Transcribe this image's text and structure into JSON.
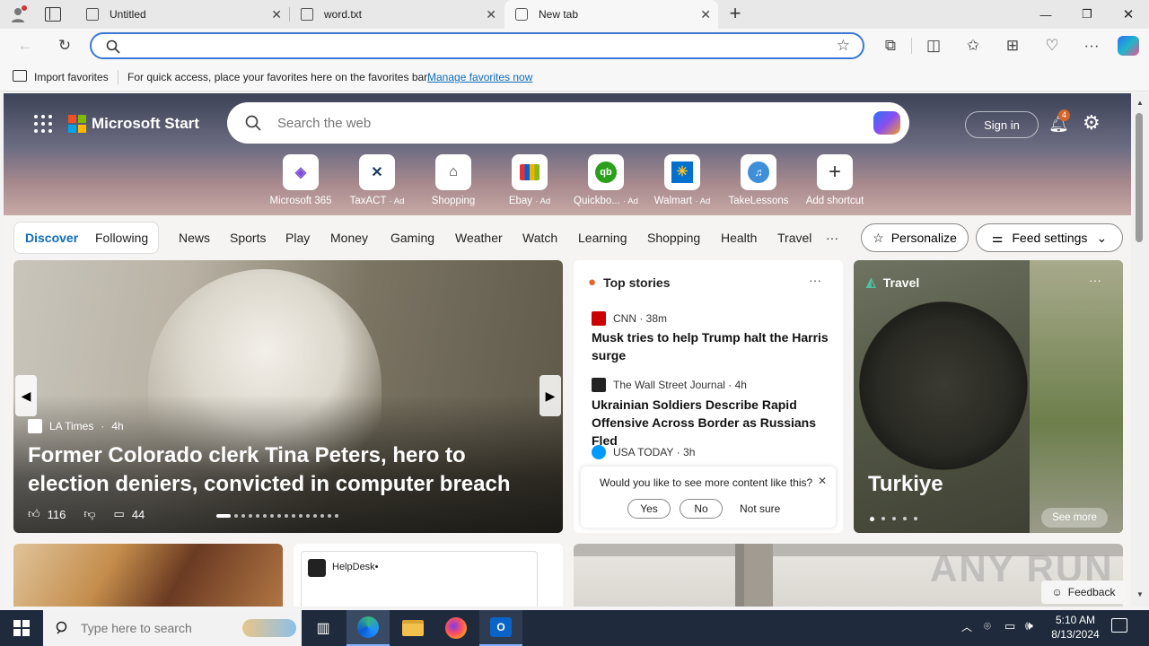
{
  "browser": {
    "tabs": [
      {
        "title": "Untitled",
        "active": false
      },
      {
        "title": "word.txt",
        "active": false
      },
      {
        "title": "New tab",
        "active": true
      }
    ],
    "address_value": "",
    "favorites_bar": {
      "import_label": "Import favorites",
      "hint": "For quick access, place your favorites here on the favorites bar.",
      "manage_link": "Manage favorites now"
    }
  },
  "start": {
    "brand": "Microsoft Start",
    "search_placeholder": "Search the web",
    "sign_in": "Sign in",
    "notification_count": "4",
    "shortcuts": [
      {
        "label": "Microsoft 365",
        "ad": ""
      },
      {
        "label": "TaxACT",
        "ad": "· Ad"
      },
      {
        "label": "Shopping",
        "ad": ""
      },
      {
        "label": "Ebay",
        "ad": "· Ad"
      },
      {
        "label": "Quickbo...",
        "ad": "· Ad"
      },
      {
        "label": "Walmart",
        "ad": "· Ad"
      },
      {
        "label": "TakeLessons",
        "ad": ""
      },
      {
        "label": "Add shortcut",
        "ad": ""
      }
    ],
    "feed_tabs": [
      "Discover",
      "Following"
    ],
    "categories": [
      "News",
      "Sports",
      "Play",
      "Money",
      "Gaming",
      "Weather",
      "Watch",
      "Learning",
      "Shopping",
      "Health",
      "Travel"
    ],
    "more_glyph": "···",
    "personalize": "Personalize",
    "feed_settings": "Feed settings"
  },
  "hero_story": {
    "source": "LA Times",
    "age": "4h",
    "headline": "Former Colorado clerk Tina Peters, hero to election deniers, convicted in computer breach",
    "likes": "116",
    "comments": "44"
  },
  "top_stories": {
    "title": "Top stories",
    "items": [
      {
        "source": "CNN",
        "age": "38m",
        "headline": "Musk tries to help Trump halt the Harris surge"
      },
      {
        "source": "The Wall Street Journal",
        "age": "4h",
        "headline": "Ukrainian Soldiers Describe Rapid Offensive Across Border as Russians Fled"
      },
      {
        "source": "USA TODAY",
        "age": "3h",
        "headline": ""
      }
    ],
    "prompt": {
      "question": "Would you like to see more content like this?",
      "yes": "Yes",
      "no": "No",
      "not_sure": "Not sure"
    }
  },
  "travel_card": {
    "label": "Travel",
    "title": "Turkiye",
    "see_more": "See more"
  },
  "bottom": {
    "helpdesk": "HelpDesk•",
    "feedback": "Feedback"
  },
  "watermark": "ANY RUN",
  "taskbar": {
    "search_placeholder": "Type here to search",
    "time": "5:10 AM",
    "date": "8/13/2024"
  },
  "colors": {
    "accent": "#0f6cbd",
    "taskbar": "#1f2a3c",
    "address_focus": "#3a78d6"
  }
}
